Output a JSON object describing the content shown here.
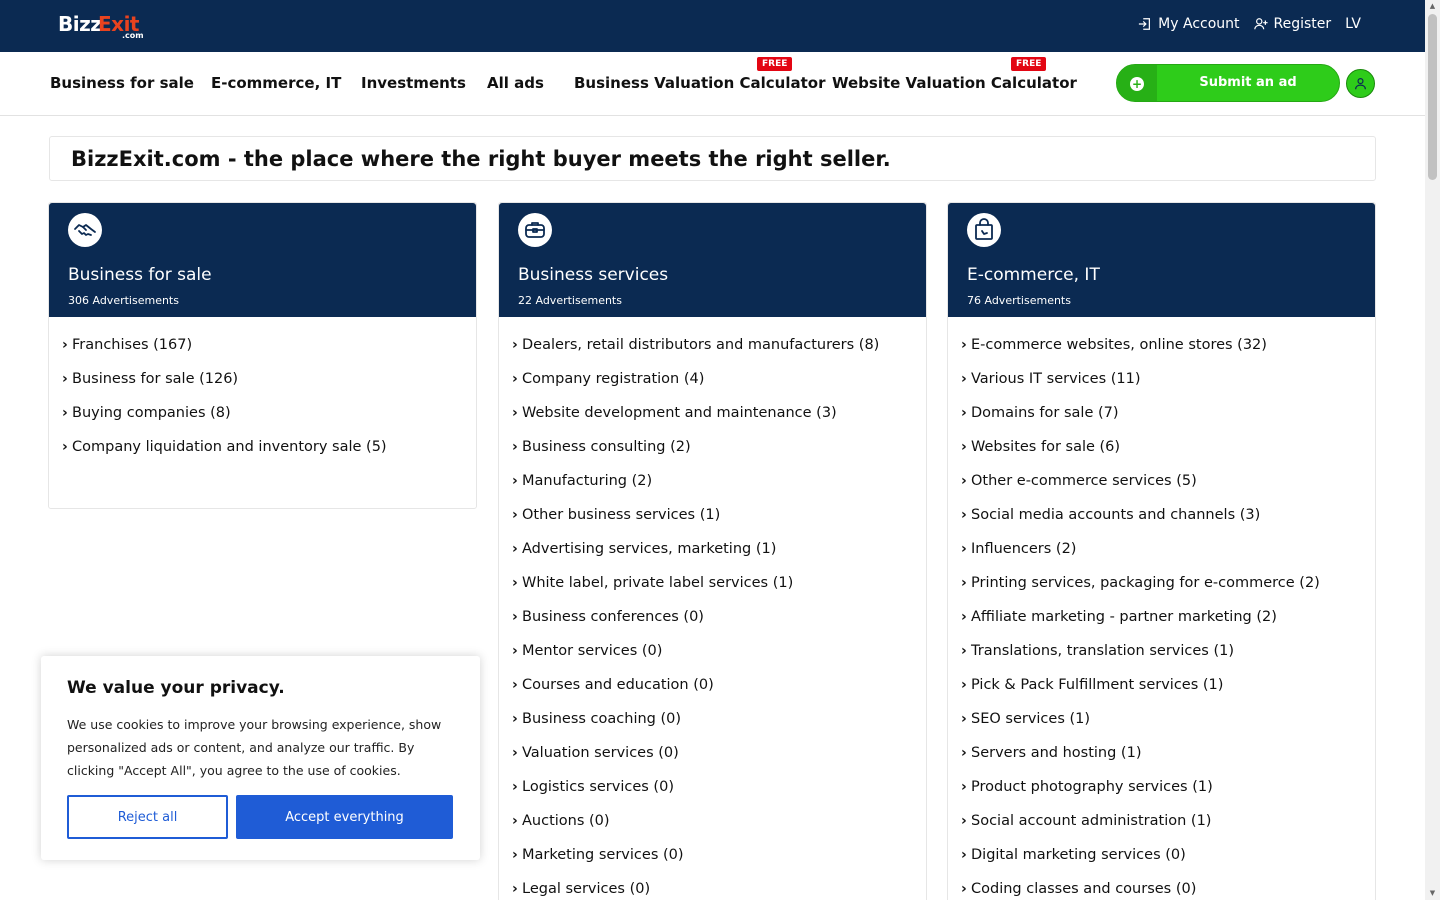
{
  "topbar": {
    "logo": {
      "main": "Bizz",
      "accent": "Exit",
      "suffix": ".com"
    },
    "my_account": "My Account",
    "register": "Register",
    "language": "LV"
  },
  "nav": {
    "items": [
      {
        "label": "Business for sale"
      },
      {
        "label": "E-commerce, IT"
      },
      {
        "label": "Investments"
      },
      {
        "label": "All ads"
      },
      {
        "label": "Business Valuation Calculator",
        "badge": "FREE"
      },
      {
        "label": "Website Valuation Calculator",
        "badge": "FREE"
      }
    ],
    "submit_label": "Submit an ad"
  },
  "headline": "BizzExit.com - the place where the right buyer meets the right seller.",
  "categories": [
    {
      "title": "Business for sale",
      "count": "306 Advertisements",
      "icon": "handshake-icon",
      "items": [
        "Franchises (167)",
        "Business for sale (126)",
        "Buying companies (8)",
        "Company liquidation and inventory sale (5)"
      ]
    },
    {
      "title": "Business services",
      "count": "22 Advertisements",
      "icon": "briefcase-icon",
      "items": [
        "Dealers, retail distributors and manufacturers (8)",
        "Company registration (4)",
        "Website development and maintenance (3)",
        "Business consulting (2)",
        "Manufacturing (2)",
        "Other business services (1)",
        "Advertising services, marketing (1)",
        "White label, private label services (1)",
        "Business conferences (0)",
        "Mentor services (0)",
        "Courses and education (0)",
        "Business coaching (0)",
        "Valuation services (0)",
        "Logistics services (0)",
        "Auctions (0)",
        "Marketing services (0)",
        "Legal services (0)"
      ]
    },
    {
      "title": "E-commerce, IT",
      "count": "76 Advertisements",
      "icon": "shopping-bag-icon",
      "items": [
        "E-commerce websites, online stores (32)",
        "Various IT services (11)",
        "Domains for sale (7)",
        "Websites for sale (6)",
        "Other e-commerce services (5)",
        "Social media accounts and channels (3)",
        "Influencers (2)",
        "Printing services, packaging for e-commerce (2)",
        "Affiliate marketing - partner marketing (2)",
        "Translations, translation services (1)",
        "Pick & Pack Fulfillment services (1)",
        "SEO services (1)",
        "Servers and hosting (1)",
        "Product photography services (1)",
        "Social account administration (1)",
        "Digital marketing services (0)",
        "Coding classes and courses (0)"
      ]
    }
  ],
  "cookie": {
    "title": "We value your privacy.",
    "text": "We use cookies to improve your browsing experience, show personalized ads or content, and analyze our traffic. By clicking \"Accept All\", you agree to the use of cookies.",
    "reject": "Reject all",
    "accept": "Accept everything"
  },
  "colors": {
    "brand_navy": "#0b2a52",
    "brand_orange": "#e8431f",
    "submit_green": "#2ecc1a",
    "free_red": "#e30613",
    "cookie_blue": "#1f5cd6"
  }
}
